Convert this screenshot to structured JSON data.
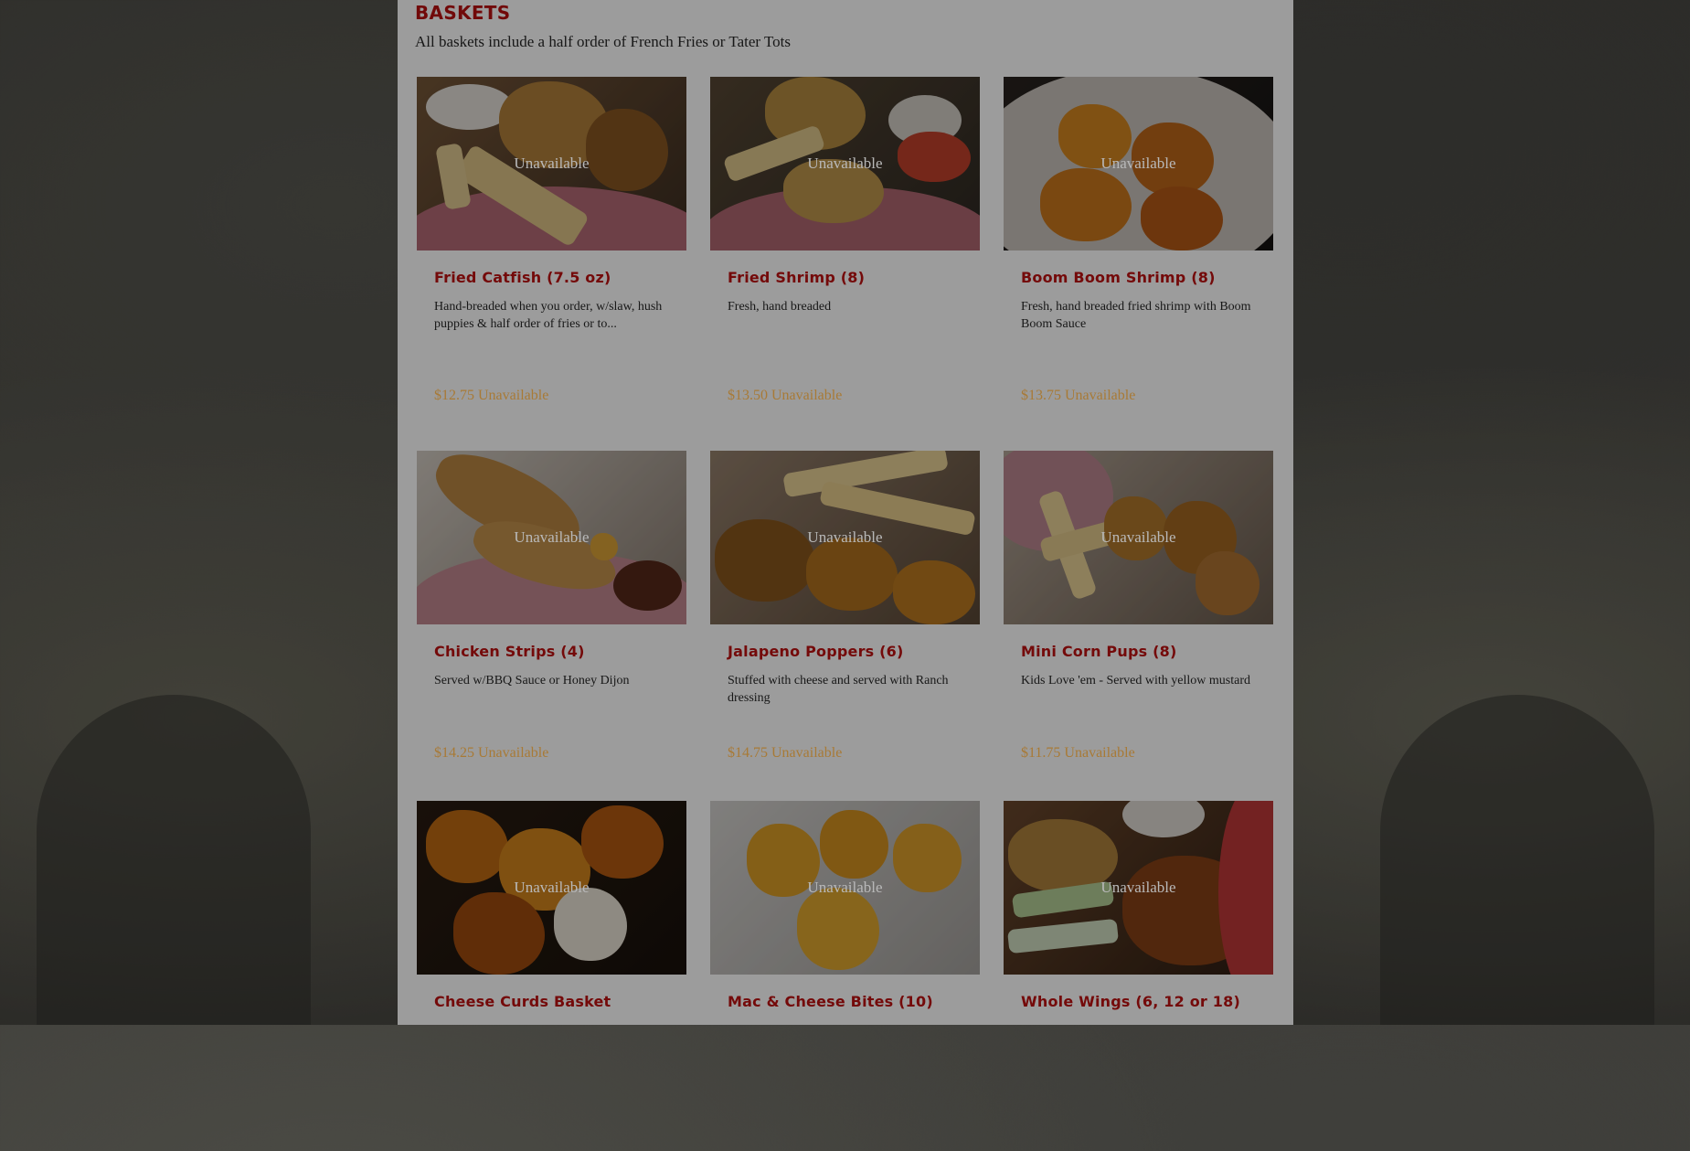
{
  "section": {
    "title": "BASKETS",
    "subtitle": "All baskets include a half order of French Fries or Tater Tots"
  },
  "status_label": "Unavailable",
  "items": [
    {
      "name": "Fried Catfish (7.5 oz)",
      "description": "Hand-breaded when you order, w/slaw, hush puppies & half order of fries or to...",
      "price": "$12.75",
      "photo_overlay": "Unavailable",
      "price_status": "Unavailable"
    },
    {
      "name": "Fried Shrimp (8)",
      "description": "Fresh, hand breaded",
      "price": "$13.50",
      "photo_overlay": "Unavailable",
      "price_status": "Unavailable"
    },
    {
      "name": "Boom Boom Shrimp (8)",
      "description": "Fresh, hand breaded fried shrimp with Boom Boom Sauce",
      "price": "$13.75",
      "photo_overlay": "Unavailable",
      "price_status": "Unavailable"
    },
    {
      "name": "Chicken Strips (4)",
      "description": "Served w/BBQ Sauce or Honey Dijon",
      "price": "$14.25",
      "photo_overlay": "Unavailable",
      "price_status": "Unavailable"
    },
    {
      "name": "Jalapeno Poppers (6)",
      "description": "Stuffed with cheese and served with Ranch dressing",
      "price": "$14.75",
      "photo_overlay": "Unavailable",
      "price_status": "Unavailable"
    },
    {
      "name": "Mini Corn Pups (8)",
      "description": "Kids Love 'em - Served with yellow mustard",
      "price": "$11.75",
      "photo_overlay": "Unavailable",
      "price_status": "Unavailable"
    },
    {
      "name": "Cheese Curds Basket",
      "description": "",
      "price": "",
      "photo_overlay": "Unavailable",
      "price_status": ""
    },
    {
      "name": "Mac & Cheese Bites (10)",
      "description": "",
      "price": "",
      "photo_overlay": "Unavailable",
      "price_status": ""
    },
    {
      "name": "Whole Wings (6, 12 or 18)",
      "description": "",
      "price": "",
      "photo_overlay": "Unavailable",
      "price_status": ""
    }
  ],
  "colors": {
    "title": "#9d0d0d",
    "item_name": "#a10f0f",
    "price": "#e9a94b",
    "panel": "#d9d9d9"
  }
}
